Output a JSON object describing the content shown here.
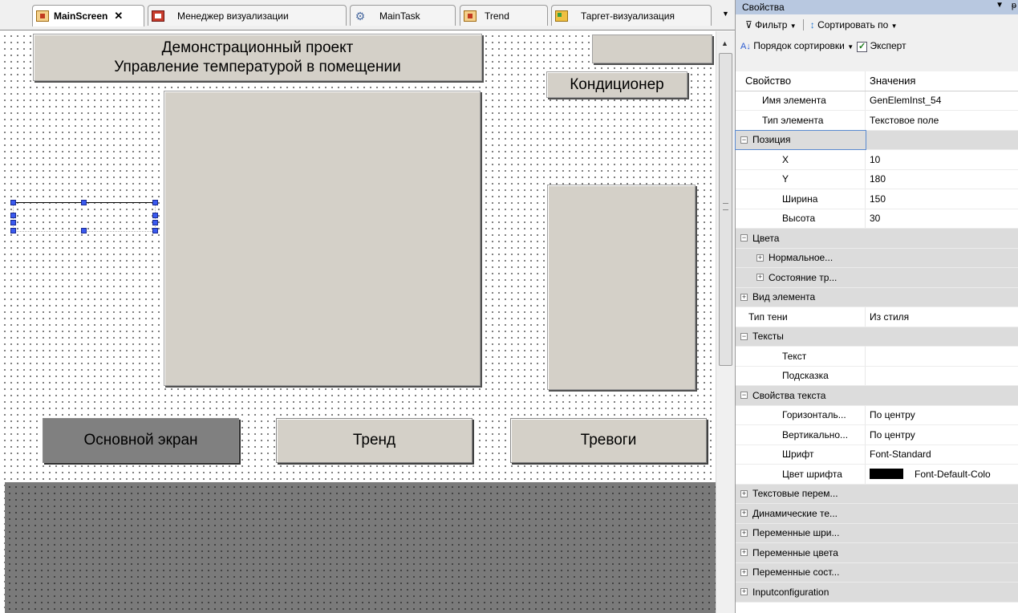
{
  "tabs": [
    {
      "label": "MainScreen",
      "icon": "visualization-icon",
      "active": true
    },
    {
      "label": "Менеджер визуализации",
      "icon": "visualization-manager-icon"
    },
    {
      "label": "MainTask",
      "icon": "task-icon"
    },
    {
      "label": "Trend",
      "icon": "visualization-icon"
    },
    {
      "label": "Таргет-визуализация",
      "icon": "target-visualization-icon"
    }
  ],
  "canvas": {
    "title_line1": "Демонстрационный проект",
    "title_line2": "Управление температурой в помещении",
    "conditioner_label": "Кондиционер",
    "nav_main": "Основной экран",
    "nav_trend": "Тренд",
    "nav_alarms": "Тревоги"
  },
  "properties": {
    "title": "Свойства",
    "filter_label": "Фильтр",
    "sort_by_label": "Сортировать по",
    "sort_order_label": "Порядок сортировки",
    "expert_label": "Эксперт",
    "expert_checked": true,
    "col_property": "Свойство",
    "col_value": "Значения",
    "rows": [
      {
        "k": "Имя элемента",
        "v": "GenElemInst_54",
        "type": "ind1"
      },
      {
        "k": "Тип элемента",
        "v": "Текстовое поле",
        "type": "ind1"
      },
      {
        "k": "Позиция",
        "v": "",
        "type": "grp",
        "exp": "minus",
        "focus": true
      },
      {
        "k": "X",
        "v": "10",
        "type": "ind2"
      },
      {
        "k": "Y",
        "v": "180",
        "type": "ind2"
      },
      {
        "k": "Ширина",
        "v": "150",
        "type": "ind2"
      },
      {
        "k": "Высота",
        "v": "30",
        "type": "ind2"
      },
      {
        "k": "Цвета",
        "v": "",
        "type": "grp",
        "exp": "minus"
      },
      {
        "k": "Нормальное...",
        "v": "",
        "type": "grp-sub",
        "exp": "plus"
      },
      {
        "k": "Состояние тр...",
        "v": "",
        "type": "grp-sub",
        "exp": "plus"
      },
      {
        "k": "Вид элемента",
        "v": "",
        "type": "grp",
        "exp": "plus"
      },
      {
        "k": "Тип тени",
        "v": "Из стиля",
        "type": "ind1p"
      },
      {
        "k": "Тексты",
        "v": "",
        "type": "grp",
        "exp": "minus"
      },
      {
        "k": "Текст",
        "v": "",
        "type": "ind2"
      },
      {
        "k": "Подсказка",
        "v": "",
        "type": "ind2"
      },
      {
        "k": "Свойства текста",
        "v": "",
        "type": "grp",
        "exp": "minus"
      },
      {
        "k": "Горизонталь...",
        "v": "По центру",
        "type": "ind2"
      },
      {
        "k": "Вертикально...",
        "v": "По центру",
        "type": "ind2"
      },
      {
        "k": "Шрифт",
        "v": "Font-Standard",
        "type": "ind2"
      },
      {
        "k": "Цвет шрифта",
        "v": "Font-Default-Colo",
        "type": "ind2",
        "swatch": "#000000"
      },
      {
        "k": "Текстовые перем...",
        "v": "",
        "type": "grp",
        "exp": "plus"
      },
      {
        "k": "Динамические те...",
        "v": "",
        "type": "grp",
        "exp": "plus"
      },
      {
        "k": "Переменные шри...",
        "v": "",
        "type": "grp",
        "exp": "plus"
      },
      {
        "k": "Переменные цвета",
        "v": "",
        "type": "grp",
        "exp": "plus"
      },
      {
        "k": "Переменные сост...",
        "v": "",
        "type": "grp",
        "exp": "plus"
      },
      {
        "k": "Inputconfiguration",
        "v": "",
        "type": "grp",
        "exp": "plus"
      }
    ]
  },
  "colors": {
    "element_fill": "#d4d0c8",
    "active_nav_fill": "#808080",
    "selection_handle": "#3a5af0",
    "panel_title_bar": "#b8c8e0"
  }
}
